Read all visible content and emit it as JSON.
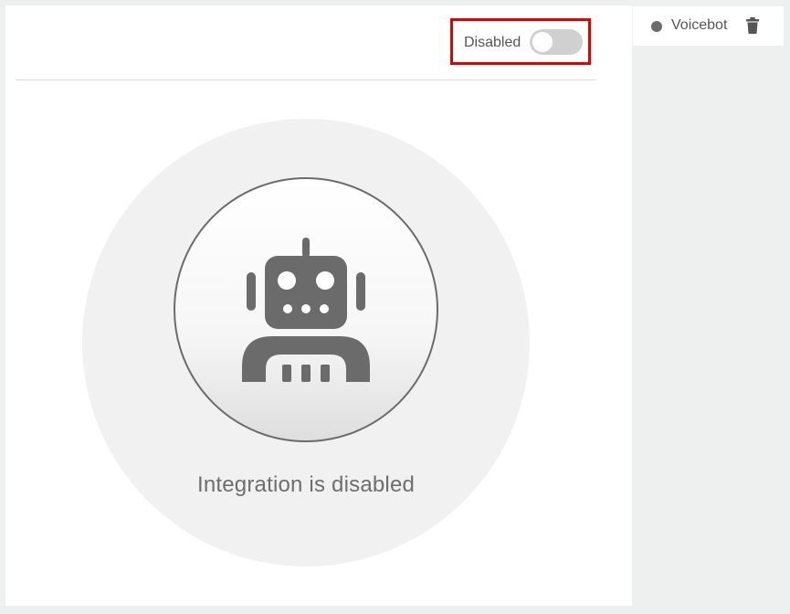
{
  "integration": {
    "toggle_label": "Disabled",
    "enabled": false,
    "status_message": "Integration is disabled"
  },
  "side_item": {
    "label": "Voicebot",
    "status_color": "#6b6b6b"
  },
  "icons": {
    "robot": "robot-icon",
    "status": "status-dot-icon",
    "delete": "trash-icon"
  },
  "colors": {
    "highlight": "#e00000",
    "toggle_off": "#d0d0d0",
    "icon_gray": "#6b6b6b"
  }
}
